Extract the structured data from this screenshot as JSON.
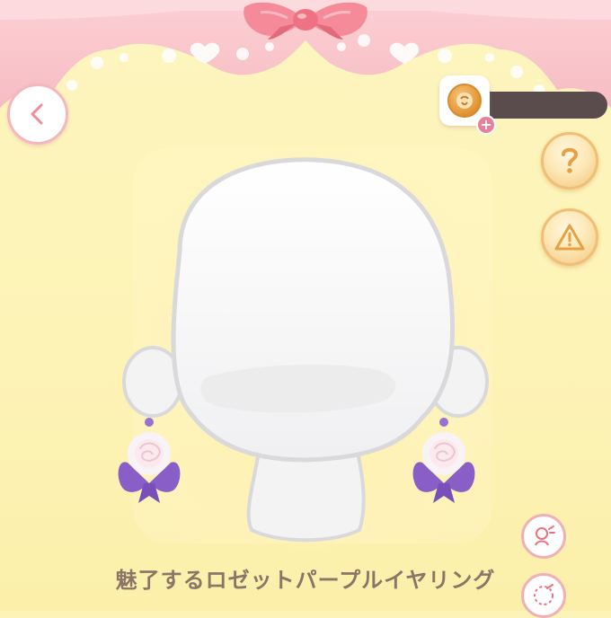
{
  "header": {
    "back_icon": "chevron-left-icon",
    "currency_icon": "coin-icon",
    "add_icon": "plus-icon"
  },
  "side_buttons": {
    "help_icon": "question-icon",
    "report_icon": "warning-icon",
    "tool1_icon": "dressup-icon",
    "tool2_icon": "dotted-circle-icon"
  },
  "item": {
    "name": "魅了するロゼットパープルイヤリング",
    "color_accent": "#8c62c4",
    "title_color": "#8c7466"
  },
  "theme": {
    "banner_pink": "#f9c7cc",
    "ribbon": "#f27a8a",
    "background": "#fdf3b8"
  }
}
